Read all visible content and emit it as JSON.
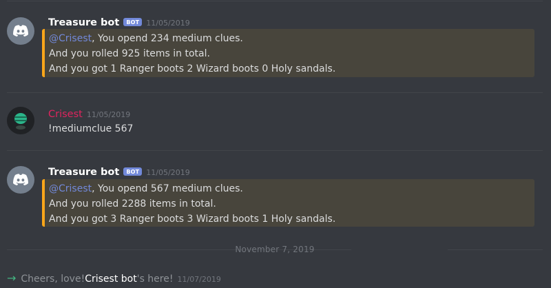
{
  "messages": [
    {
      "username": "Treasure bot",
      "bot_tag": "BOT",
      "timestamp": "11/05/2019",
      "embed": {
        "mention": "@Crisest",
        "line1_rest": ", You opend 234 medium clues.",
        "line2": "And you rolled 925 items in total.",
        "line3": "And you got 1 Ranger boots 2 Wizard boots 0 Holy sandals."
      }
    },
    {
      "username": "Crisest",
      "timestamp": "11/05/2019",
      "content": "!mediumclue 567"
    },
    {
      "username": "Treasure bot",
      "bot_tag": "BOT",
      "timestamp": "11/05/2019",
      "embed": {
        "mention": "@Crisest",
        "line1_rest": ", You opend 567 medium clues.",
        "line2": "And you rolled 2288 items in total.",
        "line3": "And you got 3 Ranger boots 3 Wizard boots 1 Holy sandals."
      }
    }
  ],
  "date_separator": "November 7, 2019",
  "join_message": {
    "prefix": "Cheers, love! ",
    "name": "Crisest bot",
    "suffix": "'s here!",
    "timestamp": "11/07/2019",
    "arrow": "→"
  },
  "colors": {
    "background": "#36393f",
    "embed_bg": "#48453c",
    "embed_border": "#faa61a",
    "mention": "#7289da",
    "bot_tag": "#7289da",
    "user_name": "#e0245e",
    "join_arrow": "#43b581"
  },
  "icons": {
    "bot_avatar": "discord-logo-icon",
    "user_avatar": "user-avatar-icon",
    "join_arrow": "arrow-right-icon"
  }
}
